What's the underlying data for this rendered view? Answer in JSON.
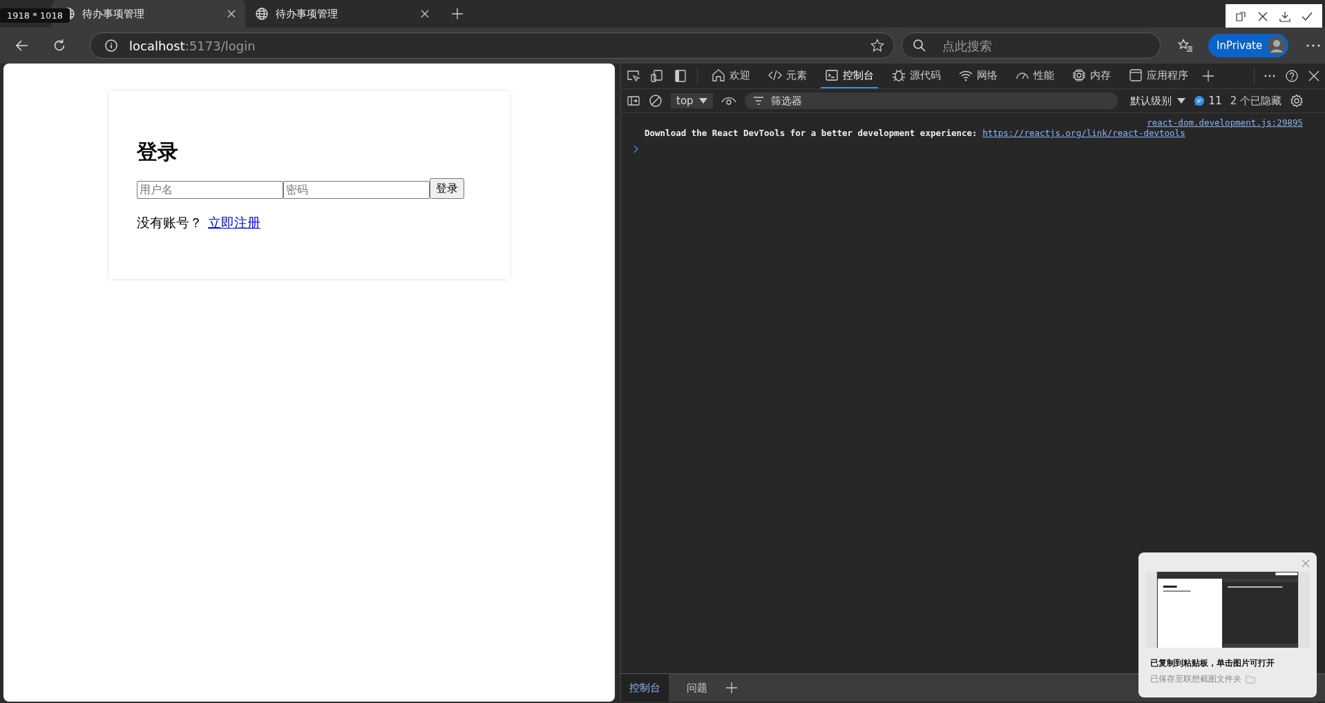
{
  "capture_size": "1918 * 1018",
  "tabs": [
    {
      "title": "待办事项管理",
      "selected": true
    },
    {
      "title": "待办事项管理",
      "selected": false
    }
  ],
  "address": {
    "host": "localhost",
    "path": ":5173/login"
  },
  "search": {
    "placeholder": "点此搜索"
  },
  "profile": {
    "label": "InPrivate"
  },
  "page": {
    "heading": "登录",
    "username_placeholder": "用户名",
    "password_placeholder": "密码",
    "submit": "登录",
    "prompt": "没有账号？",
    "link": "立即注册"
  },
  "devtools": {
    "tabs": [
      {
        "label": "欢迎",
        "kind": "home",
        "selected": false
      },
      {
        "label": "元素",
        "kind": "code",
        "selected": false
      },
      {
        "label": "控制台",
        "kind": "console",
        "selected": true
      },
      {
        "label": "源代码",
        "kind": "bug",
        "selected": false
      },
      {
        "label": "网络",
        "kind": "wifi",
        "selected": false
      },
      {
        "label": "性能",
        "kind": "gauge",
        "selected": false
      },
      {
        "label": "内存",
        "kind": "chip",
        "selected": false
      },
      {
        "label": "应用程序",
        "kind": "app",
        "selected": false
      }
    ],
    "context": "top",
    "filter_placeholder": "筛选器",
    "log_level": "默认级别",
    "message_count": "11",
    "hidden_count": "2 个已隐藏",
    "messages": [
      {
        "source": "react-dom.development.js:29895",
        "text": "Download the React DevTools for a better development experience: ",
        "link": "https://reactjs.org/link/react-devtools"
      }
    ],
    "drawer_tabs": [
      {
        "label": "控制台",
        "selected": true
      },
      {
        "label": "问题",
        "selected": false
      }
    ]
  },
  "toast": {
    "title": "已复制到粘贴板，单击图片可打开",
    "subtitle": "已保存至联想截图文件夹"
  }
}
